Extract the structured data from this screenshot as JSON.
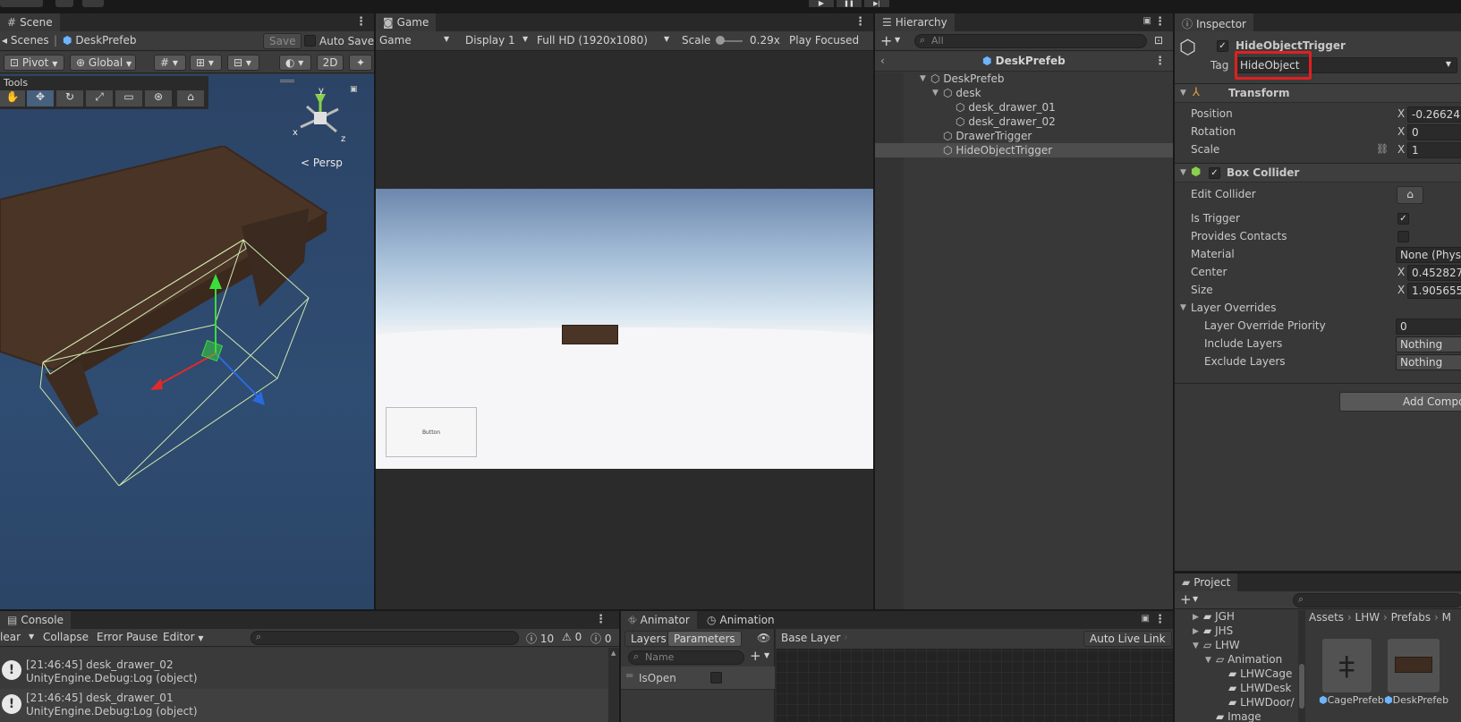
{
  "topbar": {
    "play_icon": "play-icon",
    "pause_icon": "pause-icon",
    "step_icon": "step-icon"
  },
  "scene": {
    "tab_label": "Scene",
    "breadcrumb_root": "Scenes",
    "breadcrumb_prefab": "DeskPrefeb",
    "save_label": "Save",
    "auto_save_label": "Auto Save",
    "pivot_label": "Pivot",
    "global_label": "Global",
    "mode_2d": "2D",
    "tools_label": "Tools",
    "persp_label": "Persp",
    "axis_y": "y",
    "axis_x": "x",
    "axis_z": "z"
  },
  "game": {
    "tab_label": "Game",
    "mode": "Game",
    "display": "Display 1",
    "resolution": "Full HD (1920x1080)",
    "scale_label": "Scale",
    "scale_value": "0.29x",
    "play_focused": "Play Focused",
    "ui_button_label": "Button"
  },
  "hierarchy": {
    "tab_label": "Hierarchy",
    "search_placeholder": "All",
    "header": "DeskPrefeb",
    "items": [
      {
        "label": "DeskPrefeb"
      },
      {
        "label": "desk"
      },
      {
        "label": "desk_drawer_01"
      },
      {
        "label": "desk_drawer_02"
      },
      {
        "label": "DrawerTrigger"
      },
      {
        "label": "HideObjectTrigger"
      }
    ]
  },
  "inspector": {
    "tab_label": "Inspector",
    "object_name": "HideObjectTrigger",
    "tag_label": "Tag",
    "tag_value": "HideObject",
    "transform_label": "Transform",
    "position_label": "Position",
    "position_x": "-0.26624",
    "rotation_label": "Rotation",
    "rotation_x": "0",
    "scale_label": "Scale",
    "scale_x": "1",
    "axis_x": "X",
    "box_collider_label": "Box Collider",
    "edit_collider_label": "Edit Collider",
    "is_trigger_label": "Is Trigger",
    "provides_contacts_label": "Provides Contacts",
    "material_label": "Material",
    "material_value": "None (Physic",
    "center_label": "Center",
    "center_x": "0.452827",
    "size_label": "Size",
    "size_x": "1.905655",
    "layer_overrides_label": "Layer Overrides",
    "layer_override_priority_label": "Layer Override Priority",
    "layer_override_priority_value": "0",
    "include_layers_label": "Include Layers",
    "include_layers_value": "Nothing",
    "exclude_layers_label": "Exclude Layers",
    "exclude_layers_value": "Nothing",
    "add_component_label": "Add Compo"
  },
  "project": {
    "tab_label": "Project",
    "tree": [
      {
        "label": "JGH"
      },
      {
        "label": "JHS"
      },
      {
        "label": "LHW"
      },
      {
        "label": "Animation"
      },
      {
        "label": "LHWCage"
      },
      {
        "label": "LHWDesk"
      },
      {
        "label": "LHWDoor/"
      },
      {
        "label": "Image"
      }
    ],
    "breadcrumb": [
      "Assets",
      "LHW",
      "Prefabs",
      "M"
    ],
    "assets": [
      {
        "label": "CagePrefeb"
      },
      {
        "label": "DeskPrefeb"
      }
    ]
  },
  "console": {
    "tab_label": "Console",
    "clear_label": "lear",
    "collapse_label": "Collapse",
    "error_pause_label": "Error Pause",
    "editor_label": "Editor",
    "count_info": "10",
    "count_warn": "0",
    "count_error": "0",
    "logs": [
      {
        "line1": "[21:46:45] desk_drawer_02",
        "line2": "UnityEngine.Debug:Log (object)"
      },
      {
        "line1": "[21:46:45] desk_drawer_01",
        "line2": "UnityEngine.Debug:Log (object)"
      }
    ]
  },
  "animator": {
    "tab_label": "Animator",
    "animation_tab_label": "Animation",
    "layers_label": "Layers",
    "parameters_label": "Parameters",
    "search_placeholder": "Name",
    "base_layer_label": "Base Layer",
    "auto_live_link_label": "Auto Live Link",
    "param_name": "IsOpen"
  },
  "colors": {
    "scene_bg": "#2f4a6b",
    "highlight_red": "#e02020",
    "selection": "#4d4d4d"
  }
}
